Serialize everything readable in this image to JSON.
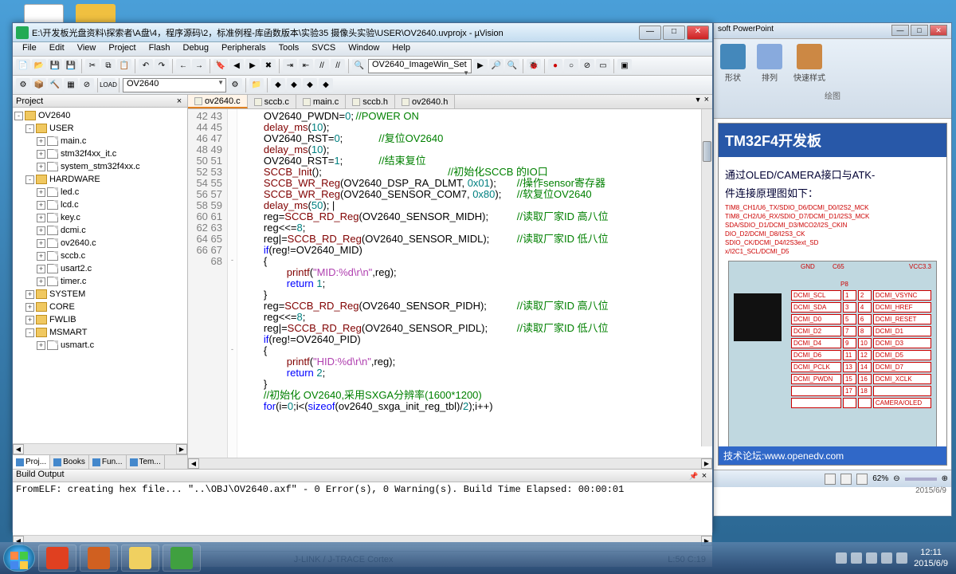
{
  "desktop": {
    "icons": [
      "paint",
      "folder"
    ]
  },
  "ppt": {
    "app": "soft PowerPoint",
    "ribbon": {
      "b1": "形状",
      "b2": "排列",
      "b3": "快速样式",
      "group": "绘图"
    },
    "slide": {
      "title": "TM32F4开发板",
      "l1": "通过OLED/CAMERA接口与ATK-",
      "l2": "件连接原理图如下：",
      "sig1": "TIM8_CH1/U6_TX/SDIO_D6/DCMI_D0/I2S2_MCK",
      "sig2": "TIM8_CH2/U6_RX/SDIO_D7/DCMI_D1/I2S3_MCK",
      "sig3": "SDA/SDIO_D1/DCMI_D3/MCO2/I2S_CKIN",
      "sig4": "DIO_D2/DCMI_D8/I2S3_CK",
      "sig5": "SDIO_CK/DCMI_D4/I2S3ext_SD",
      "sig6": "x/I2C1_SCL/DCMI_D5",
      "gnd": "GND",
      "vcc": "VCC3.3",
      "c65": "C65",
      "p8": "P8",
      "pins": [
        [
          "DCMI_SCL",
          "1",
          "2",
          "DCMI_VSYNC"
        ],
        [
          "DCMI_SDA",
          "3",
          "4",
          "DCMI_HREF"
        ],
        [
          "DCMI_D0",
          "5",
          "6",
          "DCMI_RESET"
        ],
        [
          "DCMI_D2",
          "7",
          "8",
          "DCMI_D1"
        ],
        [
          "DCMI_D4",
          "9",
          "10",
          "DCMI_D3"
        ],
        [
          "DCMI_D6",
          "11",
          "12",
          "DCMI_D5"
        ],
        [
          "DCMI_PCLK",
          "13",
          "14",
          "DCMI_D7"
        ],
        [
          "DCMI_PWDN",
          "15",
          "16",
          "DCMI_XCLK"
        ],
        [
          "",
          "17",
          "18",
          ""
        ],
        [
          "",
          "",
          "",
          "CAMERA/OLED"
        ]
      ],
      "footer": "技术论坛:www.openedv.com"
    },
    "status": {
      "zoom": "62%",
      "date": "2015/6/9"
    }
  },
  "keil": {
    "title": "E:\\开发板光盘资料\\探索者\\A盘\\4，程序源码\\2，标准例程-库函数版本\\实验35 摄像头实验\\USER\\OV2640.uvprojx - µVision",
    "menus": [
      "File",
      "Edit",
      "View",
      "Project",
      "Flash",
      "Debug",
      "Peripherals",
      "Tools",
      "SVCS",
      "Window",
      "Help"
    ],
    "combo1": "OV2640_ImageWin_Set",
    "combo2": "OV2640",
    "project": {
      "title": "Project",
      "root": "OV2640",
      "groups": [
        {
          "name": "USER",
          "exp": "-",
          "files": [
            "main.c",
            "stm32f4xx_it.c",
            "system_stm32f4xx.c"
          ]
        },
        {
          "name": "HARDWARE",
          "exp": "-",
          "files": [
            "led.c",
            "lcd.c",
            "key.c",
            "dcmi.c",
            "ov2640.c",
            "sccb.c",
            "usart2.c",
            "timer.c"
          ]
        },
        {
          "name": "SYSTEM",
          "exp": "+",
          "files": []
        },
        {
          "name": "CORE",
          "exp": "+",
          "files": []
        },
        {
          "name": "FWLIB",
          "exp": "+",
          "files": []
        },
        {
          "name": "MSMART",
          "exp": "-",
          "files": [
            "usmart.c"
          ]
        }
      ],
      "tabs": [
        "Proj...",
        "Books",
        "Fun...",
        "Tem..."
      ]
    },
    "editor": {
      "tabs": [
        "ov2640.c",
        "sccb.c",
        "main.c",
        "sccb.h",
        "ov2640.h"
      ],
      "active": 0,
      "first_line": 42,
      "lines": [
        {
          "t": "\tOV2640_PWDN=",
          "n": "0",
          "t2": ";\t",
          "c": "//POWER ON"
        },
        {
          "f": "\tdelay_ms",
          "t": "(",
          "n": "10",
          "t2": ");"
        },
        {
          "t": "\tOV2640_RST=",
          "n": "0",
          "t2": ";\t\t",
          "c": "//复位OV2640"
        },
        {
          "f": "\tdelay_ms",
          "t": "(",
          "n": "10",
          "t2": ");"
        },
        {
          "t": "\tOV2640_RST=",
          "n": "1",
          "t2": ";\t\t",
          "c": "//结束复位"
        },
        {
          "f": "\tSCCB_Init",
          "t": "();\t\t\t\t\t\t",
          "c": "//初始化SCCB 的IO口"
        },
        {
          "f": "\tSCCB_WR_Reg",
          "t": "(OV2640_DSP_RA_DLMT, ",
          "n": "0x01",
          "t2": ");\t",
          "c": "//操作sensor寄存器"
        },
        {
          "f": "\tSCCB_WR_Reg",
          "t": "(OV2640_SENSOR_COM7, ",
          "n": "0x80",
          "t2": ");\t",
          "c": "//软复位OV2640"
        },
        {
          "f": "\tdelay_ms",
          "t": "(",
          "n": "50",
          "t2": "); |"
        },
        {
          "t": "\treg=",
          "f": "SCCB_RD_Reg",
          "t2": "(OV2640_SENSOR_MIDH);\t\t",
          "c": "//读取厂家ID 高八位"
        },
        {
          "t": "\treg<<=",
          "n": "8",
          "t2": ";"
        },
        {
          "t": "\treg|=",
          "f": "SCCB_RD_Reg",
          "t2": "(OV2640_SENSOR_MIDL);\t\t",
          "c": "//读取厂家ID 低八位"
        },
        {
          "k": "\tif",
          "t": "(reg!=OV2640_MID)"
        },
        {
          "t": "\t{",
          "fold": "-"
        },
        {
          "f": "\t\tprintf",
          "t": "(",
          "s": "\"MID:%d\\r\\n\"",
          "t2": ",reg);"
        },
        {
          "k": "\t\treturn ",
          "n": "1",
          "t2": ";"
        },
        {
          "t": "\t}"
        },
        {
          "t": "\treg=",
          "f": "SCCB_RD_Reg",
          "t2": "(OV2640_SENSOR_PIDH);\t\t",
          "c": "//读取厂家ID 高八位"
        },
        {
          "t": "\treg<<=",
          "n": "8",
          "t2": ";"
        },
        {
          "t": "\treg|=",
          "f": "SCCB_RD_Reg",
          "t2": "(OV2640_SENSOR_PIDL);\t\t",
          "c": "//读取厂家ID 低八位"
        },
        {
          "k": "\tif",
          "t": "(reg!=OV2640_PID)"
        },
        {
          "t": "\t{",
          "fold": "-"
        },
        {
          "f": "\t\tprintf",
          "t": "(",
          "s": "\"HID:%d\\r\\n\"",
          "t2": ",reg);"
        },
        {
          "k": "\t\treturn ",
          "n": "2",
          "t2": ";"
        },
        {
          "t": "\t}"
        },
        {
          "c": "\t//初始化 OV2640,采用SXGA分辨率(1600*1200)"
        },
        {
          "k": "\tfor",
          "t": "(i=",
          "n": "0",
          "t2": ";i<(",
          "k2": "sizeof",
          "t3": "(ov2640_sxga_init_reg_tbl)/",
          "n2": "2",
          "t4": ");i++)"
        }
      ]
    },
    "build": {
      "title": "Build Output",
      "lines": [
        "FromELF: creating hex file...",
        "\"..\\OBJ\\OV2640.axf\" - 0 Error(s), 0 Warning(s).",
        "Build Time Elapsed:  00:00:01"
      ]
    },
    "status": {
      "debugger": "J-LINK / J-TRACE Cortex",
      "pos": "L:50 C:19"
    }
  },
  "taskbar": {
    "items": [
      "pdf",
      "ppt",
      "explorer",
      "wps"
    ],
    "colors": {
      "pdf": "#e04020",
      "ppt": "#d06020",
      "explorer": "#f0d060",
      "wps": "#40a040"
    },
    "clock": {
      "time": "12:11",
      "date": "2015/6/9"
    }
  }
}
